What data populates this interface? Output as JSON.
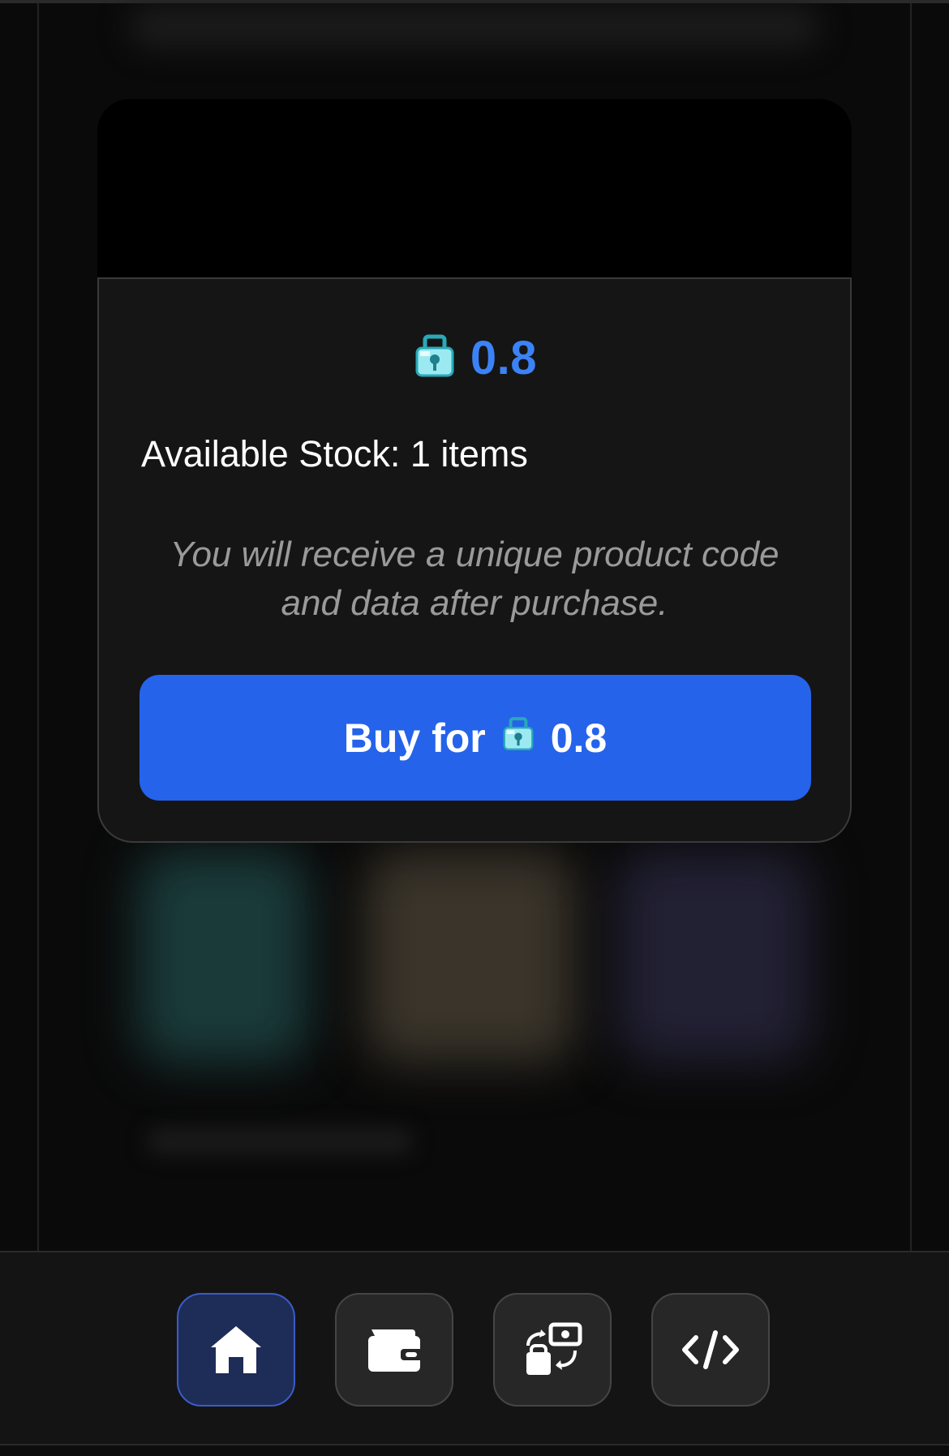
{
  "purchase": {
    "currency_icon": "lock-gem-icon",
    "price": "0.8",
    "stock_text": "Available Stock: 1 items",
    "note": "You will receive a unique product code and data after purchase.",
    "buy_prefix": "Buy for",
    "buy_price": "0.8"
  },
  "colors": {
    "accent": "#2563eb",
    "price_text": "#3b82f6",
    "icon_teal": "#5fd3e0",
    "nav_active_bg": "#1e2d57"
  },
  "nav": {
    "items": [
      {
        "icon": "home-icon",
        "active": true
      },
      {
        "icon": "wallet-icon",
        "active": false
      },
      {
        "icon": "exchange-icon",
        "active": false
      },
      {
        "icon": "code-icon",
        "active": false
      }
    ]
  }
}
